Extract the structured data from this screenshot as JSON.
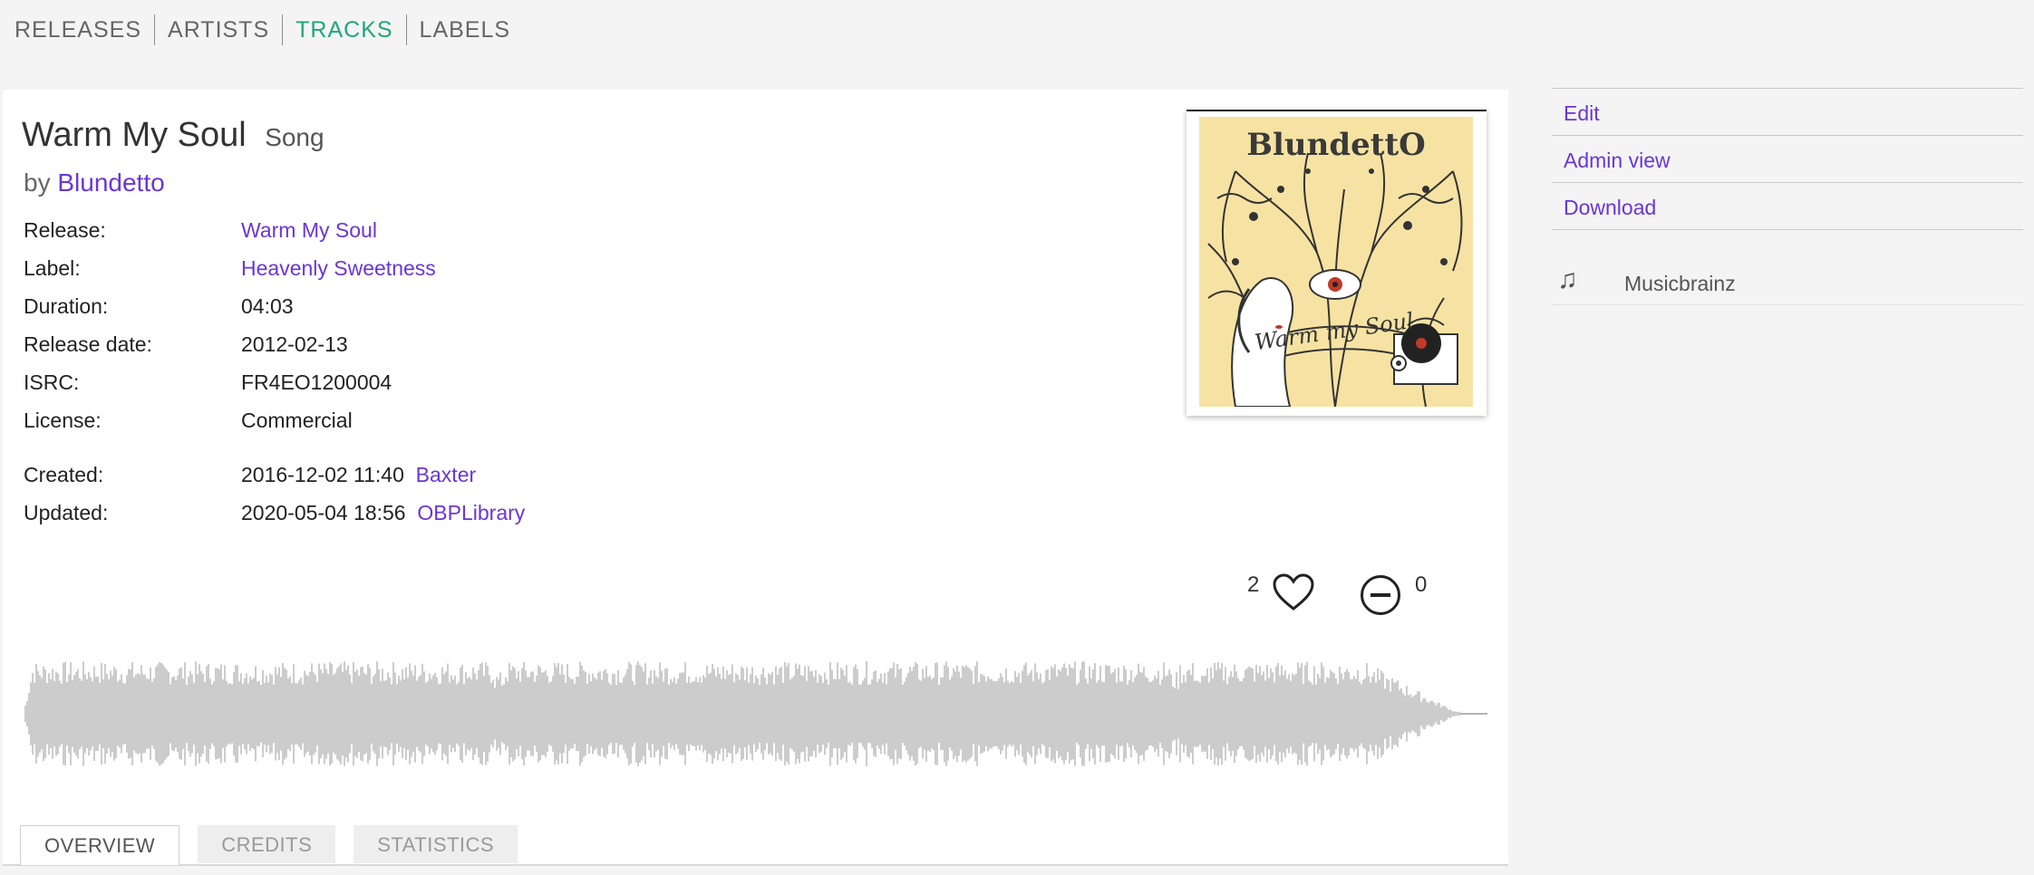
{
  "nav": [
    "RELEASES",
    "ARTISTS",
    "TRACKS",
    "LABELS"
  ],
  "nav_active": "TRACKS",
  "track": {
    "title": "Warm My Soul",
    "type": "Song",
    "by_prefix": "by",
    "artist": "Blundetto"
  },
  "details": {
    "release_label": "Release:",
    "release_value": "Warm My Soul",
    "label_label": "Label:",
    "label_value": "Heavenly Sweetness",
    "duration_label": "Duration:",
    "duration_value": "04:03",
    "release_date_label": "Release date:",
    "release_date_value": "2012-02-13",
    "isrc_label": "ISRC:",
    "isrc_value": "FR4EO1200004",
    "license_label": "License:",
    "license_value": "Commercial",
    "created_label": "Created:",
    "created_value": "2016-12-02 11:40",
    "created_by": "Baxter",
    "updated_label": "Updated:",
    "updated_value": "2020-05-04 18:56",
    "updated_by": "OBPLibrary"
  },
  "artwork": {
    "title_text": "BlundettO",
    "script_text": "Warm my Soul"
  },
  "votes": {
    "likes": "2",
    "dislikes": "0"
  },
  "tabs": [
    "OVERVIEW",
    "CREDITS",
    "STATISTICS"
  ],
  "tab_active": "OVERVIEW",
  "sidebar": {
    "edit": "Edit",
    "admin": "Admin view",
    "download": "Download"
  },
  "external": {
    "icon": "music-note-icon",
    "label": "Musicbrainz"
  },
  "colors": {
    "accent": "#6a36d6",
    "nav_active": "#1fa67a",
    "waveform": "#9a9a9a"
  }
}
